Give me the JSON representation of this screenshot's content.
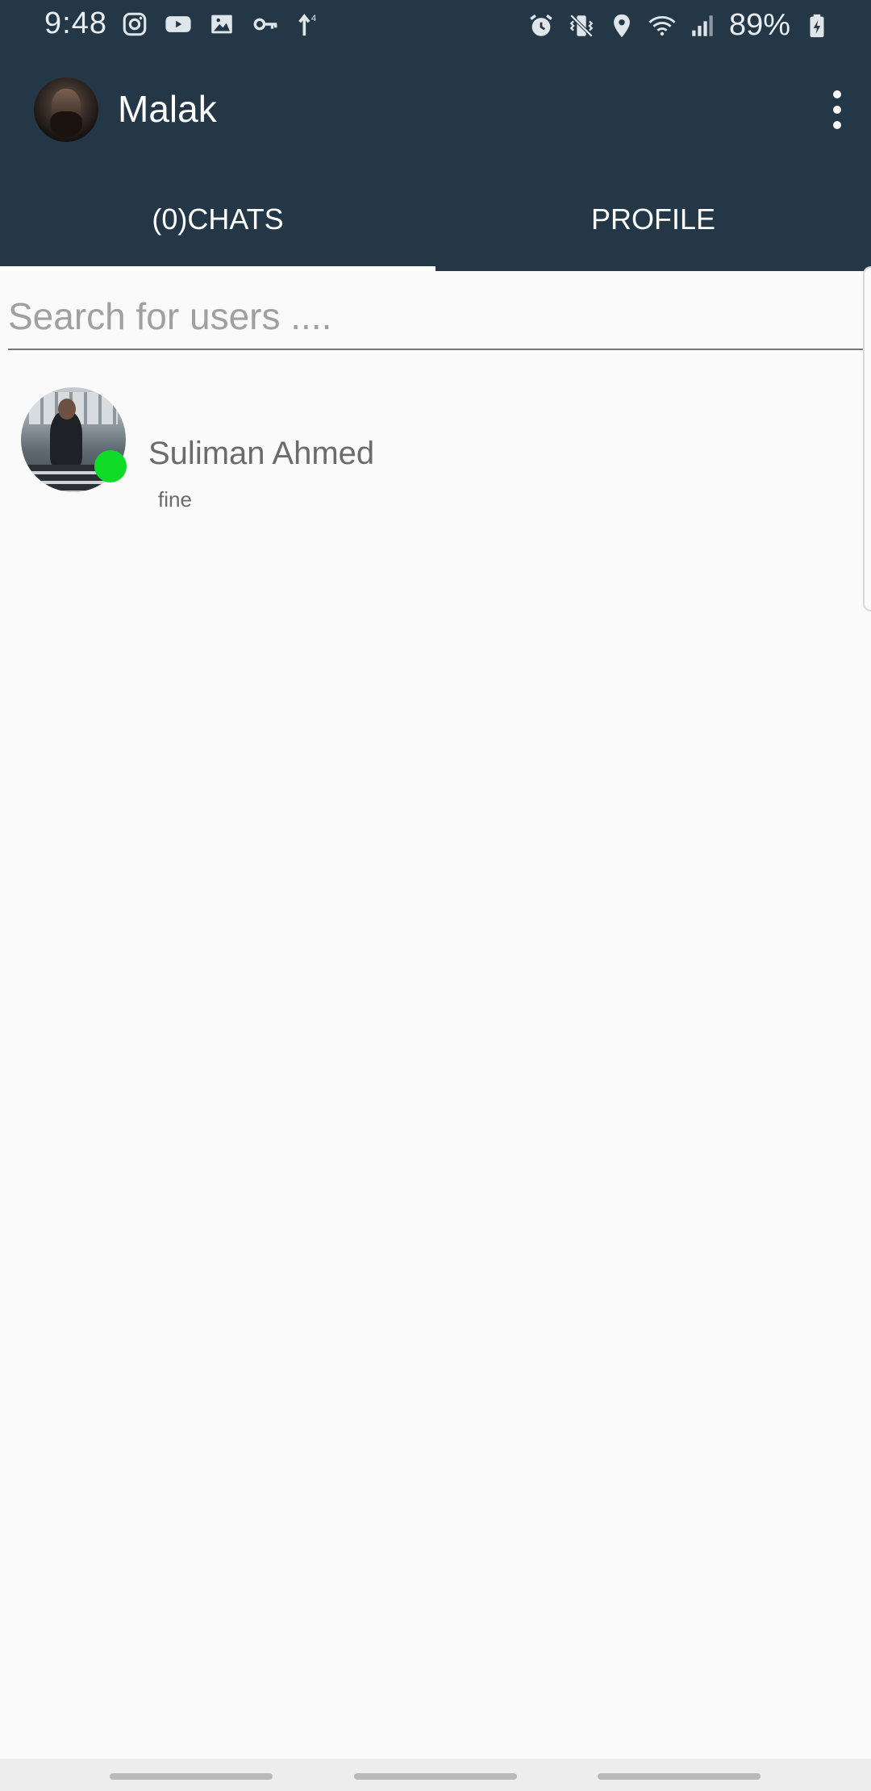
{
  "status_bar": {
    "time": "9:48",
    "battery_percent": "89%",
    "left_icons": [
      "instagram-icon",
      "youtube-icon",
      "image-icon",
      "key-icon",
      "data-arrow-icon"
    ],
    "right_icons": [
      "alarm-icon",
      "vibrate-icon",
      "location-icon",
      "wifi-icon",
      "signal-icon",
      "battery-charging-icon"
    ]
  },
  "app_bar": {
    "title": "Malak",
    "menu_icon": "more-vertical-icon"
  },
  "tabs": [
    {
      "label": "(0)CHATS",
      "selected": true
    },
    {
      "label": "PROFILE",
      "selected": false
    }
  ],
  "search": {
    "placeholder": "Search for users ....",
    "value": ""
  },
  "contacts": [
    {
      "name": "Suliman Ahmed",
      "last_message": "fine",
      "online": true
    }
  ],
  "colors": {
    "primary_dark": "#243746",
    "online": "#0edc26",
    "background": "#fafafa"
  }
}
